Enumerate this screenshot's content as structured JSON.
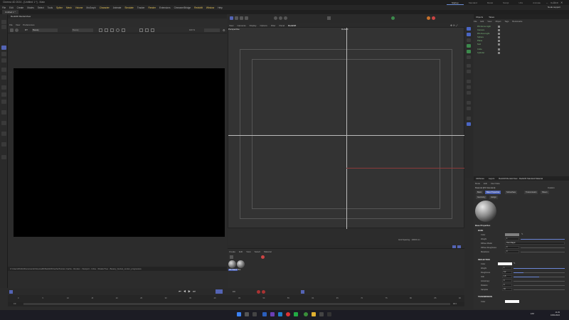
{
  "app": {
    "window_title": "Cinema 4D 2024 - [Untitled 1 *] - Main",
    "layout_tabs": [
      "Startup",
      "Standard",
      "Model",
      "Sculpt",
      "UVs",
      "Animate",
      "Redshift"
    ],
    "active_layout": "Startup",
    "user": "Node support"
  },
  "menubar": [
    "File",
    "Edit",
    "Create",
    "Modes",
    "Select",
    "Tools",
    "Spline",
    "Mesh",
    "Volume",
    "MoGraph",
    "Character",
    "Animate",
    "Simulate",
    "Tracker",
    "Render",
    "Extensions",
    "Cineware/Bridge",
    "Redshift",
    "Window",
    "Help"
  ],
  "menubar_highlight": [
    "Spline",
    "Mesh",
    "Volume",
    "Character",
    "Simulate",
    "Render",
    "Redshift",
    "Window"
  ],
  "doc_tab": "Untitled 1 *",
  "picture_viewer": {
    "title": "Redshift RenderView",
    "menus": [
      "File",
      "View",
      "Preferences"
    ],
    "toolbar_value_1": "Beauty",
    "toolbar_value_2": "Beauty",
    "zoom": "100 %",
    "status_text": "C:\\Users\\Public\\Documents\\Cinema4D\\Redshift\\Cache\\Texture Cache - Render - Viewport - Inline - ShaderTree - Beauty_bucket_render_progressive"
  },
  "viewport": {
    "menus": [
      "View",
      "Cameras",
      "Display",
      "Options",
      "Filter",
      "Panel",
      "Redshift"
    ],
    "selected_menu": "Redshift",
    "camera_label": "Perspective",
    "camera_center_label": "Default",
    "grid_spacing": "Grid Spacing : 10000 cm"
  },
  "material_manager": {
    "menus": [
      "Create",
      "Edit",
      "View",
      "Select",
      "Material"
    ],
    "materials": [
      "RS Stand",
      "Mat"
    ]
  },
  "object_manager": {
    "tabs": [
      "Objects",
      "Takes"
    ],
    "menus": [
      "File",
      "Edit",
      "View",
      "Object",
      "Tags",
      "Bookmarks"
    ],
    "objects": [
      "RS Dome Light",
      "Camera",
      "RS Area Light",
      "Sphere",
      "Plane",
      "Null",
      "Cube",
      "Cylinder"
    ]
  },
  "attribute_manager": {
    "tabs": [
      "Attributes",
      "Layers",
      "Redshift RenderView - Redshift Standard Material"
    ],
    "menus": [
      "Mode",
      "Edit",
      "User Data"
    ],
    "object_name": "Material [RS Standard]",
    "mode": "Custom",
    "subtabs_row1": [
      "Basic",
      "Base Properties",
      "Subsurface",
      "Transmission",
      "Sheen",
      "Thin Film",
      "Coat",
      "Emission"
    ],
    "active_subtab": "Base Properties",
    "subtabs_row2": [
      "Geometry",
      "Assign"
    ],
    "section_title": "Base Properties",
    "base": {
      "header": "BASE",
      "props": [
        {
          "label": "Color",
          "value": ""
        },
        {
          "label": "Weight",
          "value": "1"
        },
        {
          "label": "Diffuse Model",
          "value": "Oren-Nayar"
        },
        {
          "label": "Diffuse Roughness",
          "value": "0"
        },
        {
          "label": "Metalness",
          "value": "0"
        }
      ]
    },
    "reflection": {
      "header": "REFLECTION",
      "props": [
        {
          "label": "Color",
          "value": ""
        },
        {
          "label": "Weight",
          "value": "1"
        },
        {
          "label": "Roughness",
          "value": "0.2"
        },
        {
          "label": "IOR",
          "value": "1.5"
        },
        {
          "label": "Anisotropy",
          "value": "0"
        },
        {
          "label": "Rotation",
          "value": "0"
        },
        {
          "label": "Samples",
          "value": "16"
        }
      ]
    },
    "transmission": {
      "header": "TRANSMISSION",
      "props": [
        {
          "label": "Color",
          "value": ""
        }
      ]
    }
  },
  "timeline": {
    "current_frame": "0 F",
    "ticks": [
      "0",
      "5",
      "10",
      "15",
      "20",
      "25",
      "30",
      "35",
      "40",
      "45",
      "50",
      "55",
      "60",
      "65",
      "70",
      "75",
      "80",
      "85",
      "90"
    ],
    "start": "0 F",
    "end": "90 F",
    "right_field": "90 F"
  },
  "taskbar": {
    "lang": "ESP",
    "time": "11:29",
    "date": "16/01/2024"
  },
  "colors": {
    "accent": "#5464b4",
    "highlight_menu": "#e6c45a",
    "object_green": "#7fbf7f"
  }
}
